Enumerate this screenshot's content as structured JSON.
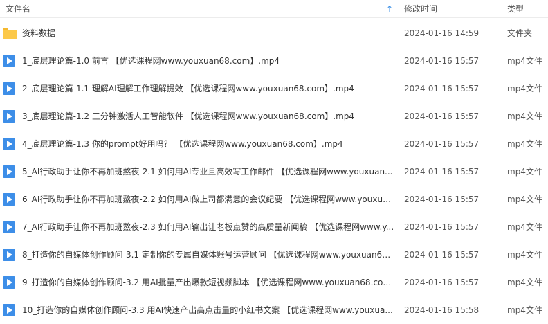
{
  "header": {
    "name_label": "文件名",
    "time_label": "修改时间",
    "type_label": "类型",
    "sort_glyph": "↑"
  },
  "rows": [
    {
      "name": "资料数据",
      "time": "2024-01-16 14:59",
      "type": "文件夹",
      "icon": "folder-icon"
    },
    {
      "name": "1_底层理论篇-1.0 前言 【优选课程网www.youxuan68.com】.mp4",
      "time": "2024-01-16 15:57",
      "type": "mp4文件",
      "icon": "video-file-icon"
    },
    {
      "name": "2_底层理论篇-1.1 理解AI理解工作理解提效 【优选课程网www.youxuan68.com】.mp4",
      "time": "2024-01-16 15:57",
      "type": "mp4文件",
      "icon": "video-file-icon"
    },
    {
      "name": "3_底层理论篇-1.2 三分钟激活人工智能软件 【优选课程网www.youxuan68.com】.mp4",
      "time": "2024-01-16 15:57",
      "type": "mp4文件",
      "icon": "video-file-icon"
    },
    {
      "name": "4_底层理论篇-1.3 你的prompt好用吗？ 【优选课程网www.youxuan68.com】.mp4",
      "time": "2024-01-16 15:57",
      "type": "mp4文件",
      "icon": "video-file-icon"
    },
    {
      "name": "5_AI行政助手让你不再加班熬夜-2.1 如何用AI专业且高效写工作邮件 【优选课程网www.youxuan...",
      "time": "2024-01-16 15:57",
      "type": "mp4文件",
      "icon": "video-file-icon"
    },
    {
      "name": "6_AI行政助手让你不再加班熬夜-2.2 如何用AI做上司都满意的会议纪要 【优选课程网www.youxua...",
      "time": "2024-01-16 15:57",
      "type": "mp4文件",
      "icon": "video-file-icon"
    },
    {
      "name": "7_AI行政助手让你不再加班熬夜-2.3 如何用AI输出让老板点赞的高质量新闻稿 【优选课程网www.y...",
      "time": "2024-01-16 15:57",
      "type": "mp4文件",
      "icon": "video-file-icon"
    },
    {
      "name": "8_打造你的自媒体创作顾问-3.1 定制你的专属自媒体账号运营顾问 【优选课程网www.youxuan68....",
      "time": "2024-01-16 15:57",
      "type": "mp4文件",
      "icon": "video-file-icon"
    },
    {
      "name": "9_打造你的自媒体创作顾问-3.2 用AI批量产出爆款短视频脚本 【优选课程网www.youxuan68.com...",
      "time": "2024-01-16 15:57",
      "type": "mp4文件",
      "icon": "video-file-icon"
    },
    {
      "name": "10_打造你的自媒体创作顾问-3.3 用AI快速产出高点击量的小红书文案 【优选课程网www.youxua...",
      "time": "2024-01-16 15:58",
      "type": "mp4文件",
      "icon": "video-file-icon"
    }
  ]
}
